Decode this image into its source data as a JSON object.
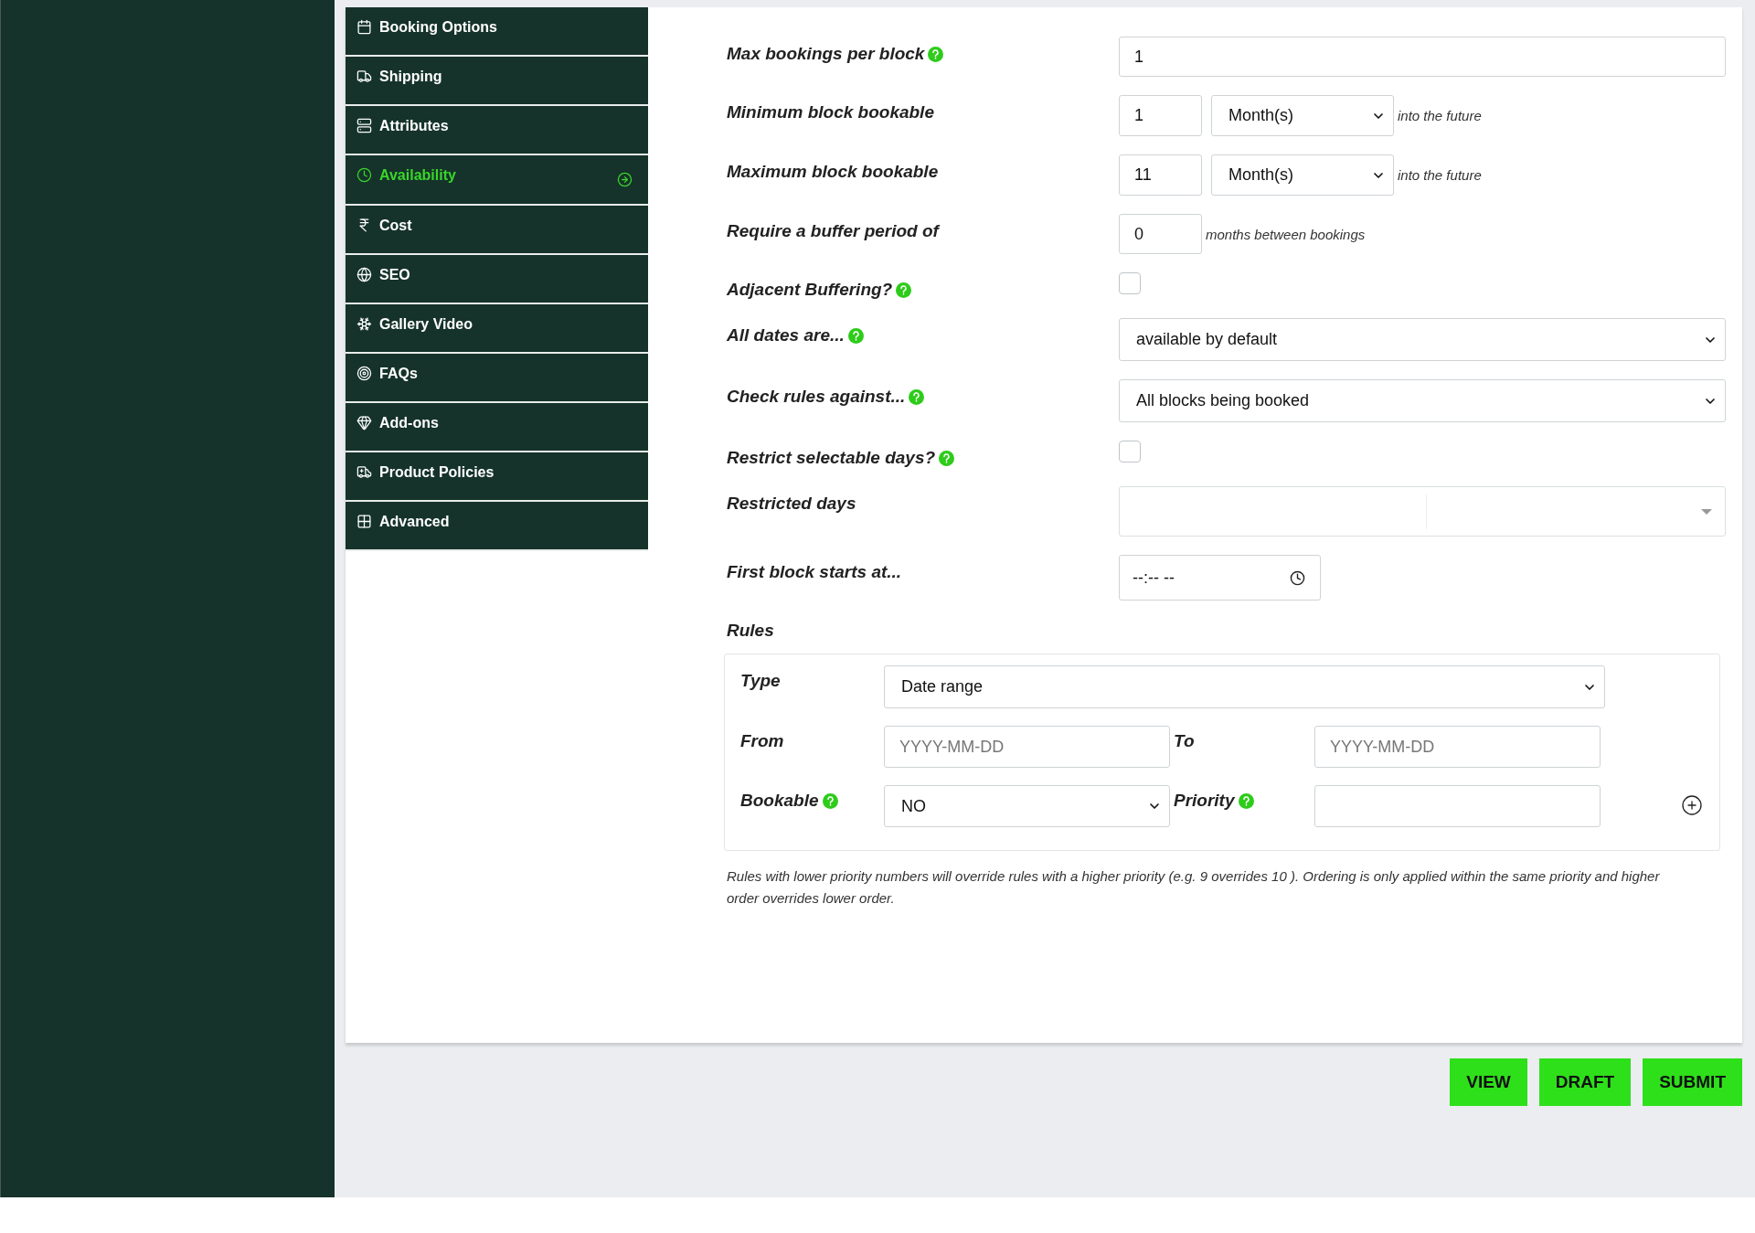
{
  "product_menu": [
    {
      "label": "Booking Options",
      "selected": false
    },
    {
      "label": "Shipping",
      "selected": false
    },
    {
      "label": "Attributes",
      "selected": false
    },
    {
      "label": "Availability",
      "selected": true
    },
    {
      "label": "Cost",
      "selected": false
    },
    {
      "label": "SEO",
      "selected": false
    },
    {
      "label": "Gallery Video",
      "selected": false
    },
    {
      "label": "FAQs",
      "selected": false
    },
    {
      "label": "Add-ons",
      "selected": false
    },
    {
      "label": "Product Policies",
      "selected": false
    },
    {
      "label": "Advanced",
      "selected": false
    }
  ],
  "fields": [
    {
      "kind": "text",
      "label": "Max bookings per block",
      "help": true,
      "value": "1"
    },
    {
      "kind": "number_unit",
      "label": "Minimum block bookable",
      "help": false,
      "value": "1",
      "unit": "Month(s)",
      "suffix": "into the future"
    },
    {
      "kind": "number_unit",
      "label": "Maximum block bookable",
      "help": false,
      "value": "11",
      "unit": "Month(s)",
      "suffix": "into the future"
    },
    {
      "kind": "number_suffix",
      "label": "Require a buffer period of",
      "help": false,
      "value": "0",
      "suffix": "months between bookings"
    },
    {
      "kind": "checkbox",
      "label": "Adjacent Buffering?",
      "help": true,
      "checked": false
    },
    {
      "kind": "select",
      "label": "All dates are...",
      "help": true,
      "value": "available by default"
    },
    {
      "kind": "select",
      "label": "Check rules against...",
      "help": true,
      "value": "All blocks being booked"
    },
    {
      "kind": "checkbox",
      "label": "Restrict selectable days?",
      "help": true,
      "checked": false
    },
    {
      "kind": "multiselect",
      "label": "Restricted days",
      "help": false
    },
    {
      "kind": "time",
      "label": "First block starts at...",
      "help": false,
      "value": "--:-- --"
    }
  ],
  "rules": {
    "label": "Rules",
    "type": {
      "label": "Type",
      "value": "Date range"
    },
    "from": {
      "label": "From",
      "placeholder": "YYYY-MM-DD"
    },
    "to": {
      "label": "To",
      "placeholder": "YYYY-MM-DD"
    },
    "bookable": {
      "label": "Bookable",
      "help": true,
      "value": "NO"
    },
    "priority": {
      "label": "Priority",
      "help": true
    },
    "note": "Rules with lower priority numbers will override rules with a higher priority (e.g. 9 overrides 10 ). Ordering is only applied within the same priority and higher order overrides lower order."
  },
  "buttons": [
    "VIEW",
    "DRAFT",
    "SUBMIT"
  ]
}
